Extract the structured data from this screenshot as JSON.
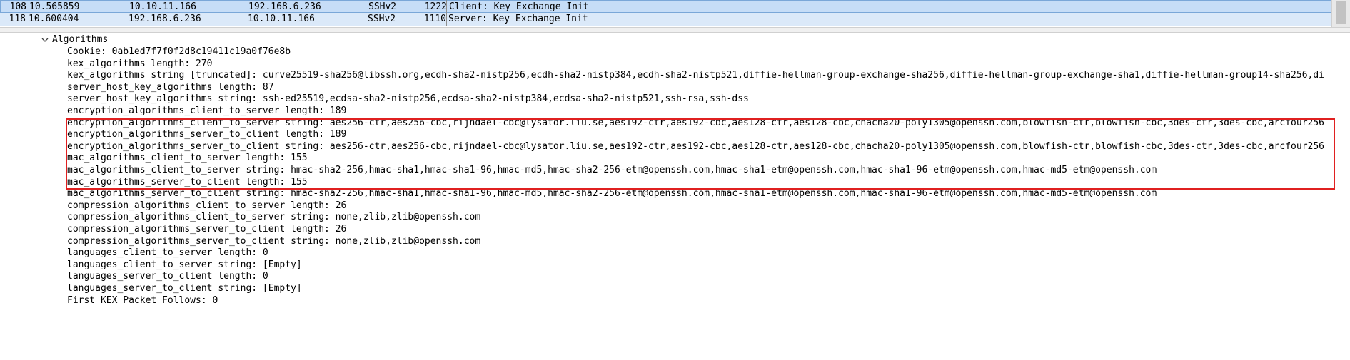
{
  "packet_list": {
    "rows": [
      {
        "no": "108",
        "time": "10.565859",
        "source": "10.10.11.166",
        "destination": "192.168.6.236",
        "protocol": "SSHv2",
        "length": "1222",
        "info": "Client: Key Exchange Init",
        "selected": true
      },
      {
        "no": "118",
        "time": "10.600404",
        "source": "192.168.6.236",
        "destination": "10.10.11.166",
        "protocol": "SSHv2",
        "length": "1110",
        "info": "Server: Key Exchange Init",
        "selected": false
      }
    ]
  },
  "details": {
    "root_label": "Algorithms",
    "root_expanded_icon": "chevron-down-icon",
    "fields": [
      "Cookie: 0ab1ed7f7f0f2d8c19411c19a0f76e8b",
      "kex_algorithms length: 270",
      "kex_algorithms string [truncated]: curve25519-sha256@libssh.org,ecdh-sha2-nistp256,ecdh-sha2-nistp384,ecdh-sha2-nistp521,diffie-hellman-group-exchange-sha256,diffie-hellman-group-exchange-sha1,diffie-hellman-group14-sha256,di",
      "server_host_key_algorithms length: 87",
      "server_host_key_algorithms string: ssh-ed25519,ecdsa-sha2-nistp256,ecdsa-sha2-nistp384,ecdsa-sha2-nistp521,ssh-rsa,ssh-dss",
      "encryption_algorithms_client_to_server length: 189",
      "encryption_algorithms_client_to_server string: aes256-ctr,aes256-cbc,rijndael-cbc@lysator.liu.se,aes192-ctr,aes192-cbc,aes128-ctr,aes128-cbc,chacha20-poly1305@openssh.com,blowfish-ctr,blowfish-cbc,3des-ctr,3des-cbc,arcfour256",
      "encryption_algorithms_server_to_client length: 189",
      "encryption_algorithms_server_to_client string: aes256-ctr,aes256-cbc,rijndael-cbc@lysator.liu.se,aes192-ctr,aes192-cbc,aes128-ctr,aes128-cbc,chacha20-poly1305@openssh.com,blowfish-ctr,blowfish-cbc,3des-ctr,3des-cbc,arcfour256",
      "mac_algorithms_client_to_server length: 155",
      "mac_algorithms_client_to_server string: hmac-sha2-256,hmac-sha1,hmac-sha1-96,hmac-md5,hmac-sha2-256-etm@openssh.com,hmac-sha1-etm@openssh.com,hmac-sha1-96-etm@openssh.com,hmac-md5-etm@openssh.com",
      "mac_algorithms_server_to_client length: 155",
      "mac_algorithms_server_to_client string: hmac-sha2-256,hmac-sha1,hmac-sha1-96,hmac-md5,hmac-sha2-256-etm@openssh.com,hmac-sha1-etm@openssh.com,hmac-sha1-96-etm@openssh.com,hmac-md5-etm@openssh.com",
      "compression_algorithms_client_to_server length: 26",
      "compression_algorithms_client_to_server string: none,zlib,zlib@openssh.com",
      "compression_algorithms_server_to_client length: 26",
      "compression_algorithms_server_to_client string: none,zlib,zlib@openssh.com",
      "languages_client_to_server length: 0",
      "languages_client_to_server string: [Empty]",
      "languages_server_to_client length: 0",
      "languages_server_to_client string: [Empty]",
      "First KEX Packet Follows: 0"
    ]
  },
  "colors": {
    "selected_row_bg": "#c6ddf7",
    "row_bg": "#dbe9f9",
    "highlight_border": "#e02020"
  }
}
